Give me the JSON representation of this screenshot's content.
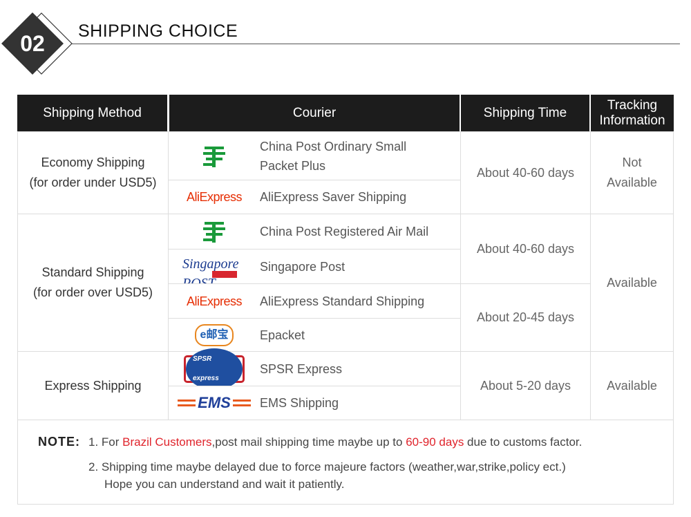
{
  "section": {
    "number": "02",
    "title": "SHIPPING CHOICE"
  },
  "headers": {
    "method": "Shipping Method",
    "courier": "Courier",
    "time": "Shipping Time",
    "tracking": "Tracking Information"
  },
  "groups": [
    {
      "method": "Economy Shipping",
      "method_note": "(for order under USD5)",
      "tracking": "Not Available",
      "couriers": [
        {
          "logo": "china-post-logo",
          "name": "China Post Ordinary Small Packet Plus"
        },
        {
          "logo": "aliexpress-logo",
          "logo_text": "AliExpress",
          "name": "AliExpress Saver Shipping"
        }
      ],
      "times": [
        "About 40-60 days"
      ]
    },
    {
      "method": "Standard Shipping",
      "method_note": "(for order over USD5)",
      "tracking": "Available",
      "couriers": [
        {
          "logo": "china-post-logo",
          "name": "China Post Registered Air Mail"
        },
        {
          "logo": "singapore-post-logo",
          "logo_text": "Singapore POST",
          "name": "Singapore Post"
        },
        {
          "logo": "aliexpress-logo",
          "logo_text": "AliExpress",
          "name": "AliExpress Standard Shipping"
        },
        {
          "logo": "epacket-logo",
          "logo_text": "e邮宝",
          "name": "Epacket"
        }
      ],
      "times": [
        "About 40-60 days",
        "About 20-45 days"
      ]
    },
    {
      "method": "Express Shipping",
      "tracking": "Available",
      "couriers": [
        {
          "logo": "spsr-logo",
          "logo_text": "SPSR express",
          "name": "SPSR Express"
        },
        {
          "logo": "ems-logo",
          "logo_text": "EMS",
          "name": "EMS Shipping"
        }
      ],
      "times": [
        "About 5-20 days"
      ]
    }
  ],
  "note": {
    "label": "NOTE:",
    "line1_a": "1. For ",
    "line1_b": "Brazil Customers",
    "line1_c": ",post mail shipping time maybe up to ",
    "line1_d": "60-90 days",
    "line1_e": " due to customs factor.",
    "line2": "2. Shipping time maybe delayed due to force majeure factors (weather,war,strike,policy ect.)",
    "line3": "Hope you can understand and wait it patiently."
  },
  "colors": {
    "header_bg": "#1c1c1c",
    "accent_red": "#e0242c",
    "china_post_green": "#1a9a3a"
  }
}
